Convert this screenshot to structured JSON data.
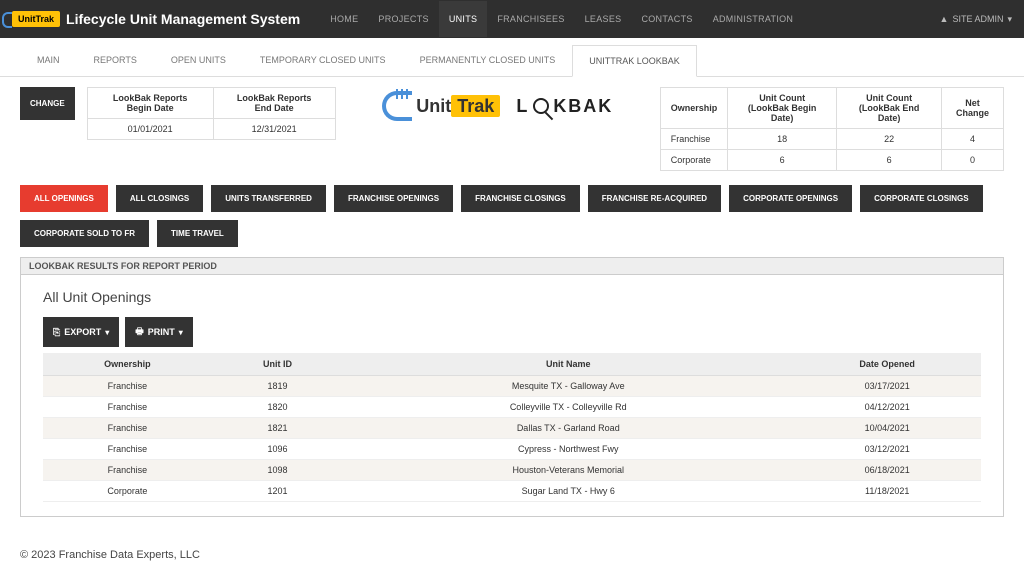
{
  "header": {
    "brand_tag": "UnitTrak",
    "app_title": "Lifecycle Unit Management System",
    "nav": [
      "HOME",
      "PROJECTS",
      "UNITS",
      "FRANCHISEES",
      "LEASES",
      "CONTACTS",
      "ADMINISTRATION"
    ],
    "nav_active": 2,
    "user_menu": "SITE ADMIN"
  },
  "subtabs": {
    "items": [
      "MAIN",
      "REPORTS",
      "OPEN UNITS",
      "TEMPORARY CLOSED UNITS",
      "PERMANENTLY CLOSED UNITS",
      "UNITTRAK LOOKBAK"
    ],
    "active": 5
  },
  "controls": {
    "change_label": "CHANGE",
    "date_headers": [
      "LookBak Reports Begin Date",
      "LookBak Reports End Date"
    ],
    "date_values": [
      "01/01/2021",
      "12/31/2021"
    ]
  },
  "logos": {
    "unittrak": {
      "part1": "Unit",
      "part2": "Trak"
    },
    "lookbak": {
      "part1": "L",
      "part2": "KBAK"
    }
  },
  "counts": {
    "headers": [
      "Ownership",
      "Unit Count (LookBak Begin Date)",
      "Unit Count (LookBak End Date)",
      "Net Change"
    ],
    "rows": [
      [
        "Franchise",
        "18",
        "22",
        "4"
      ],
      [
        "Corporate",
        "6",
        "6",
        "0"
      ]
    ]
  },
  "pills": [
    "ALL OPENINGS",
    "ALL CLOSINGS",
    "UNITS TRANSFERRED",
    "FRANCHISE OPENINGS",
    "FRANCHISE CLOSINGS",
    "FRANCHISE RE-ACQUIRED",
    "CORPORATE OPENINGS",
    "CORPORATE CLOSINGS",
    "CORPORATE SOLD TO FR",
    "TIME TRAVEL"
  ],
  "pills_active": 0,
  "panel": {
    "strip": "LOOKBAK RESULTS FOR REPORT PERIOD",
    "title": "All Unit Openings",
    "export_label": "EXPORT",
    "print_label": "PRINT",
    "columns": [
      "Ownership",
      "Unit ID",
      "Unit Name",
      "Date Opened"
    ],
    "rows": [
      [
        "Franchise",
        "1819",
        "Mesquite TX - Galloway Ave",
        "03/17/2021"
      ],
      [
        "Franchise",
        "1820",
        "Colleyville TX - Colleyville Rd",
        "04/12/2021"
      ],
      [
        "Franchise",
        "1821",
        "Dallas TX - Garland Road",
        "10/04/2021"
      ],
      [
        "Franchise",
        "1096",
        "Cypress - Northwest Fwy",
        "03/12/2021"
      ],
      [
        "Franchise",
        "1098",
        "Houston-Veterans Memorial",
        "06/18/2021"
      ],
      [
        "Corporate",
        "1201",
        "Sugar Land TX - Hwy 6",
        "11/18/2021"
      ]
    ]
  },
  "footer": "© 2023 Franchise Data Experts, LLC",
  "colors": {
    "accent_red": "#e73c2f",
    "dark": "#333333",
    "brand_yellow": "#ffc107",
    "brand_blue": "#4a90d9"
  }
}
